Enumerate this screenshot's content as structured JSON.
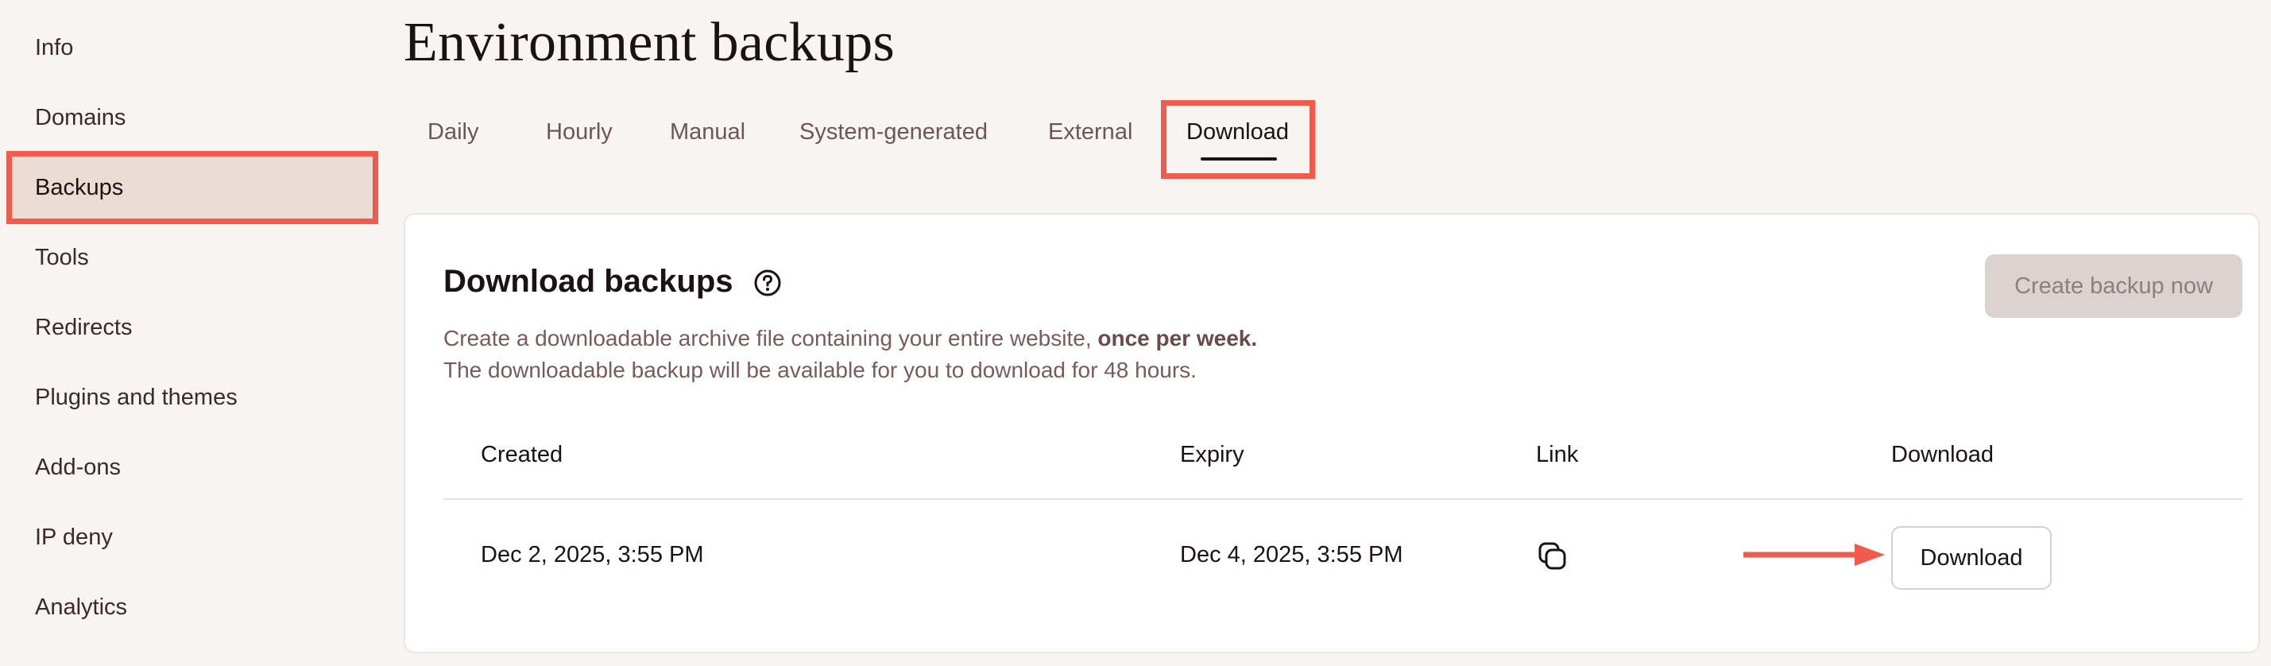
{
  "sidebar": {
    "items": [
      {
        "label": "Info"
      },
      {
        "label": "Domains"
      },
      {
        "label": "Backups"
      },
      {
        "label": "Tools"
      },
      {
        "label": "Redirects"
      },
      {
        "label": "Plugins and themes"
      },
      {
        "label": "Add-ons"
      },
      {
        "label": "IP deny"
      },
      {
        "label": "Analytics"
      }
    ],
    "active": "Backups"
  },
  "page": {
    "title": "Environment backups"
  },
  "tabs": [
    {
      "label": "Daily"
    },
    {
      "label": "Hourly"
    },
    {
      "label": "Manual"
    },
    {
      "label": "System-generated"
    },
    {
      "label": "External"
    },
    {
      "label": "Download"
    }
  ],
  "active_tab": "Download",
  "card": {
    "title": "Download backups",
    "create_button": "Create backup now",
    "description_line1": "Create a downloadable archive file containing your entire website, ",
    "description_line1_bold": "once per week.",
    "description_line2": "The downloadable backup will be available for you to download for 48 hours.",
    "table": {
      "headers": [
        "Created",
        "Expiry",
        "Link",
        "Download"
      ],
      "rows": [
        {
          "created": "Dec 2, 2025, 3:55 PM",
          "expiry": "Dec 4, 2025, 3:55 PM",
          "download_label": "Download"
        }
      ]
    }
  },
  "colors": {
    "highlight": "#f25a4c",
    "active_sidebar_bg": "#ebddd4",
    "page_bg": "#f8f4f1"
  }
}
